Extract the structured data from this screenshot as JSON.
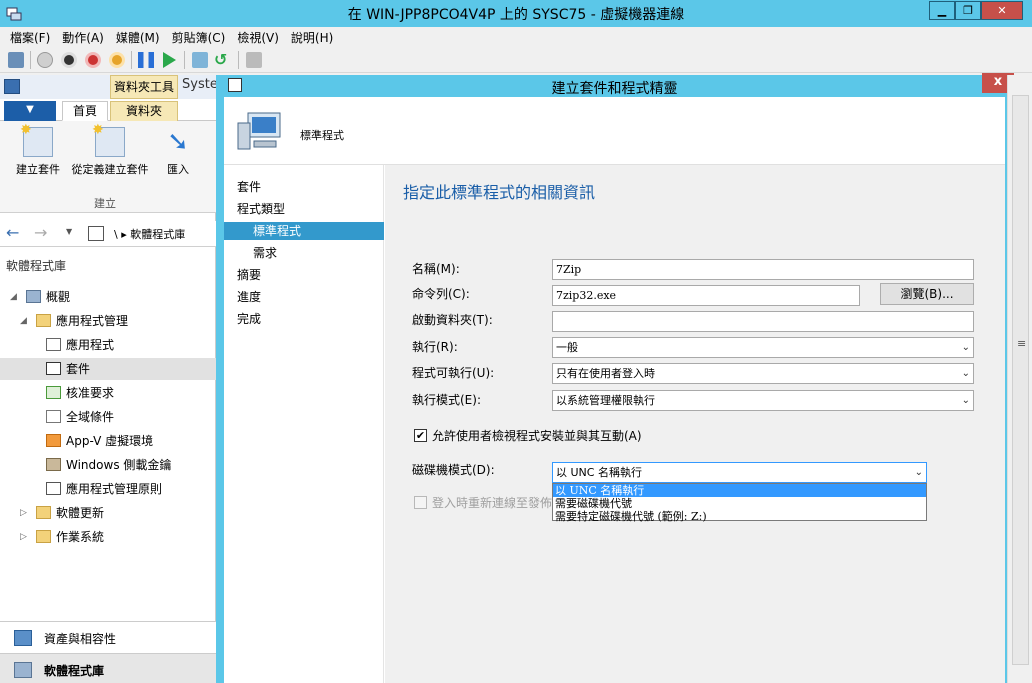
{
  "window": {
    "title": "在 WIN-JPP8PCO4V4P 上的 SYSC75 - 虛擬機器連線",
    "minimize": "▁",
    "restore": "❐",
    "close": "✕"
  },
  "menu": [
    "檔案(F)",
    "動作(A)",
    "媒體(M)",
    "剪貼簿(C)",
    "檢視(V)",
    "說明(H)"
  ],
  "console": {
    "ribbon_context": "資料夾工具",
    "ribbon_context_extra": "Syste",
    "tabs": [
      "首頁",
      "資料夾"
    ],
    "ribbon_buttons": [
      "建立套件",
      "從定義建立套件",
      "匯入"
    ],
    "ribbon_group": "建立",
    "address_path": "\\  ▸  軟體程式庫",
    "library_title": "軟體程式庫",
    "tree": [
      {
        "label": "概觀"
      },
      {
        "label": "應用程式管理"
      },
      {
        "label": "應用程式"
      },
      {
        "label": "套件"
      },
      {
        "label": "核准要求"
      },
      {
        "label": "全域條件"
      },
      {
        "label": "App-V 虛擬環境"
      },
      {
        "label": "Windows 側載金鑰"
      },
      {
        "label": "應用程式管理原則"
      },
      {
        "label": "軟體更新"
      },
      {
        "label": "作業系統"
      }
    ],
    "bottom_nav": [
      "資產與相容性",
      "軟體程式庫"
    ]
  },
  "wizard": {
    "title": "建立套件和程式精靈",
    "close": "x",
    "header_title": "標準程式",
    "nav": [
      "套件",
      "程式類型",
      "標準程式",
      "需求",
      "摘要",
      "進度",
      "完成"
    ],
    "heading": "指定此標準程式的相關資訊",
    "fields": {
      "name_label": "名稱(M):",
      "name_value": "7Zip",
      "cmd_label": "命令列(C):",
      "cmd_value": "7zip32.exe",
      "browse": "瀏覽(B)...",
      "startdir_label": "啟動資料夾(T):",
      "startdir_value": "",
      "run_label": "執行(R):",
      "run_value": "一般",
      "canrun_label": "程式可執行(U):",
      "canrun_value": "只有在使用者登入時",
      "runmode_label": "執行模式(E):",
      "runmode_value": "以系統管理權限執行",
      "allow_interact": "允許使用者檢視程式安裝並與其互動(A)",
      "drive_label": "磁碟機模式(D):",
      "drive_value": "以 UNC 名稱執行",
      "drive_options": [
        "以 UNC 名稱執行",
        "需要磁碟機代號",
        "需要特定磁碟機代號 (範例: Z:)"
      ],
      "reconnect": "登入時重新連線至發佈"
    }
  },
  "colors": {
    "accent": "#5bc7e8",
    "selection": "#3399cc",
    "highlight": "#3399ff"
  }
}
